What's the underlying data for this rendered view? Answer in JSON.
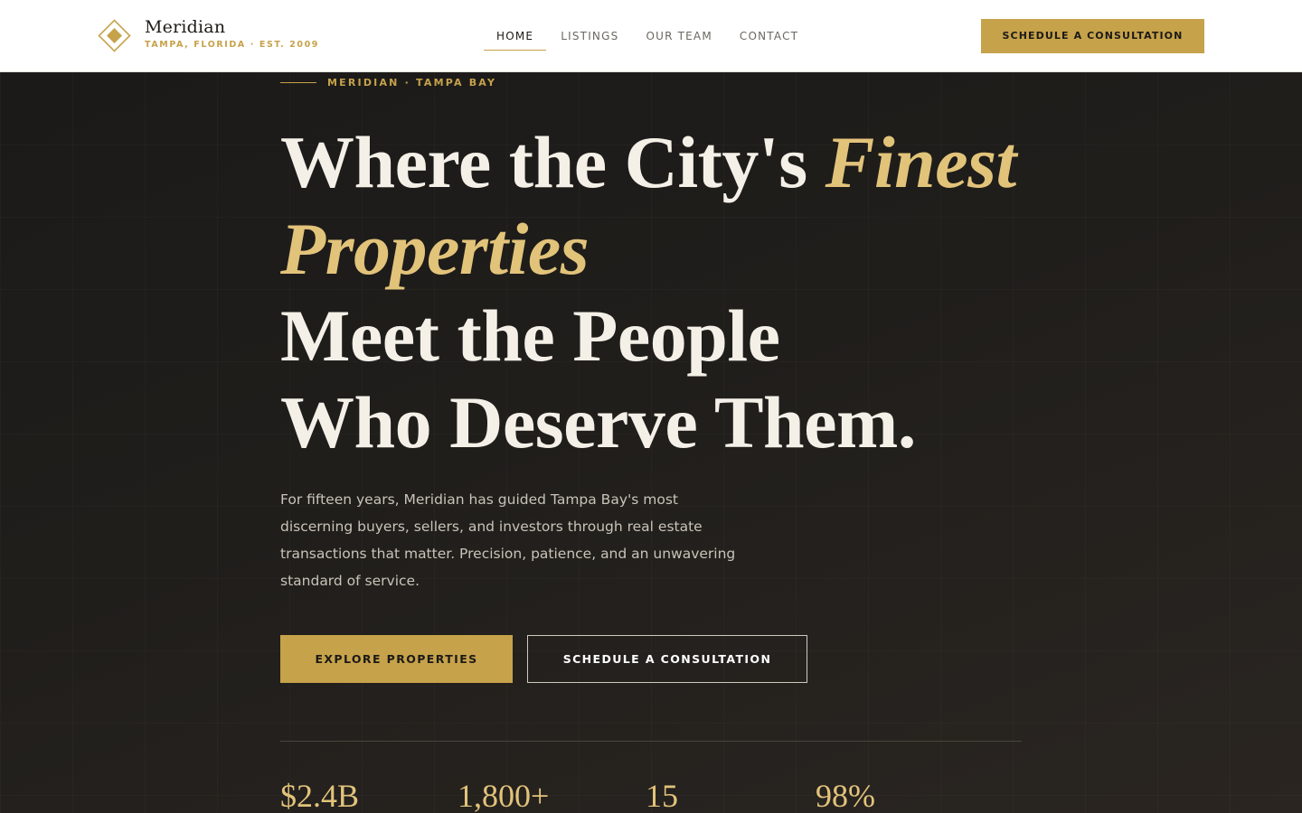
{
  "brand": {
    "name": "Meridian",
    "tagline": "TAMPA, FLORIDA · EST. 2009",
    "logo_icon": "diamond-logo-icon",
    "accent_color": "#c6a24a"
  },
  "nav": {
    "items": [
      {
        "label": "HOME",
        "active": true
      },
      {
        "label": "LISTINGS",
        "active": false
      },
      {
        "label": "OUR TEAM",
        "active": false
      },
      {
        "label": "CONTACT",
        "active": false
      }
    ],
    "cta_label": "SCHEDULE A CONSULTATION"
  },
  "hero": {
    "eyebrow": "MERIDIAN · TAMPA BAY",
    "headline": {
      "line1_plain": "Where the City's ",
      "line1_gold": "Finest",
      "line2_gold": "Properties",
      "line3": "Meet the People",
      "line4": "Who Deserve Them."
    },
    "description": "For fifteen years, Meridian has guided Tampa Bay's most discerning buyers, sellers, and investors through real estate transactions that matter. Precision, patience, and an unwavering standard of service.",
    "primary_button": "EXPLORE PROPERTIES",
    "secondary_button": "SCHEDULE A CONSULTATION"
  },
  "stats": [
    {
      "value": "$2.4B"
    },
    {
      "value": "1,800+"
    },
    {
      "value": "15"
    },
    {
      "value": "98%"
    }
  ]
}
